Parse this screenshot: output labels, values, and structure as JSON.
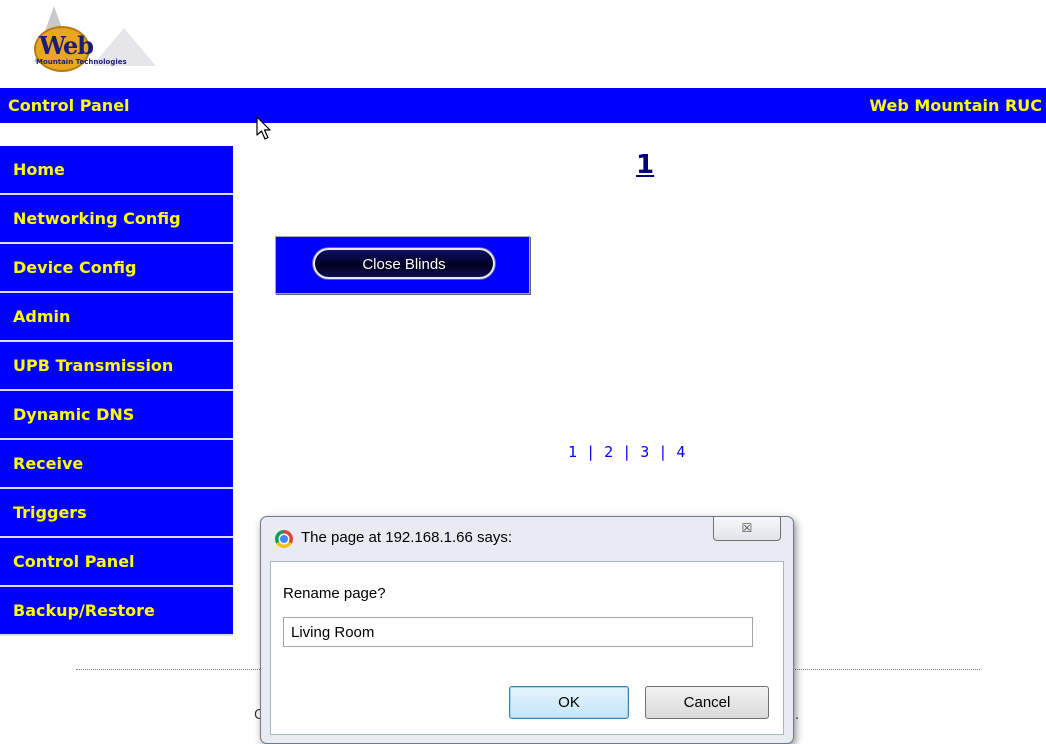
{
  "logo": {
    "word": "Web",
    "tagline": "Mountain Technologies"
  },
  "topbar": {
    "left_title": "Control Panel",
    "right_title": "Web Mountain RUC"
  },
  "sidebar": {
    "items": [
      {
        "label": "Home"
      },
      {
        "label": "Networking Config"
      },
      {
        "label": "Device Config"
      },
      {
        "label": "Admin"
      },
      {
        "label": "UPB Transmission"
      },
      {
        "label": "Dynamic DNS"
      },
      {
        "label": "Receive"
      },
      {
        "label": "Triggers"
      },
      {
        "label": "Control Panel"
      },
      {
        "label": "Backup/Restore"
      }
    ]
  },
  "main": {
    "page_number": "1",
    "close_blinds_label": "Close Blinds",
    "pager": {
      "p1": "1",
      "p2": "2",
      "p3": "3",
      "p4": "4",
      "sep": "|"
    },
    "footer_left": "C",
    "footer_right": "."
  },
  "dialog": {
    "title": "The page at 192.168.1.66 says:",
    "close_glyph": "☒",
    "prompt": "Rename page?",
    "input_value": "Living Room",
    "ok_label": "OK",
    "cancel_label": "Cancel"
  },
  "colors": {
    "nav_bg": "#0000ff",
    "nav_text": "#ffff00",
    "link": "#0000ff",
    "page_number": "#000080"
  }
}
